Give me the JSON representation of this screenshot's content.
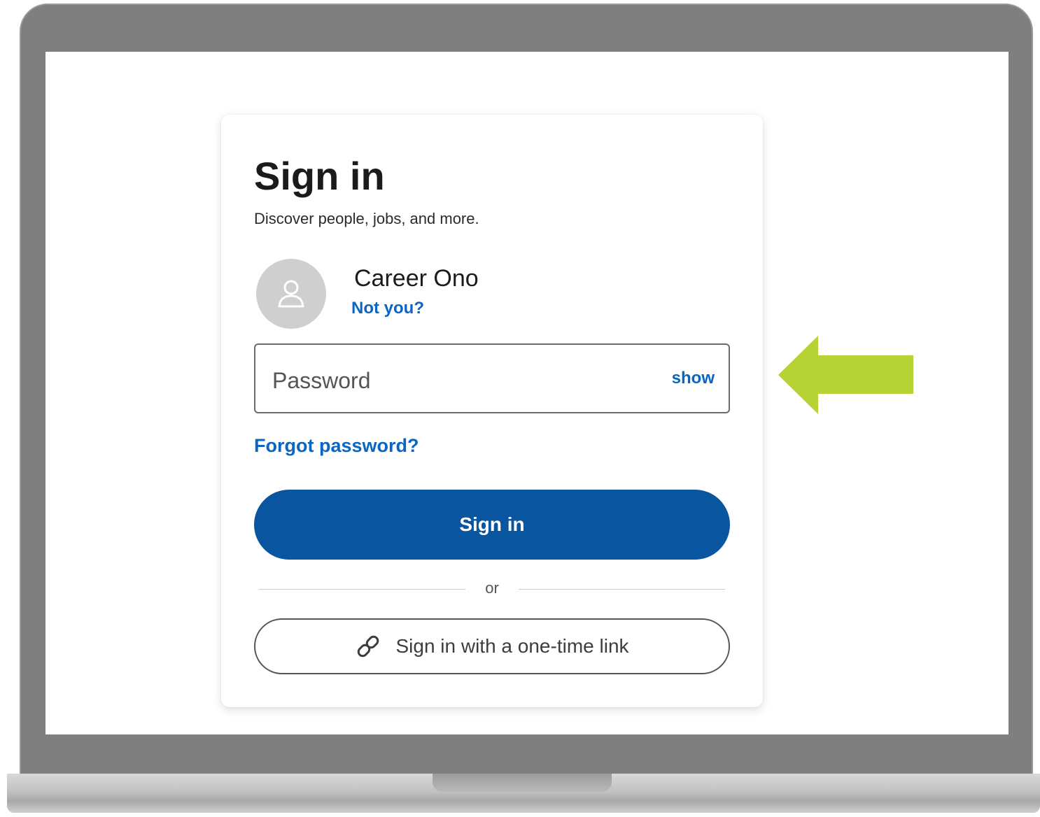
{
  "signin": {
    "title": "Sign in",
    "subtitle": "Discover people, jobs, and more.",
    "user": {
      "name": "Career Ono",
      "not_you": "Not you?"
    },
    "password": {
      "placeholder": "Password",
      "value": "",
      "show_label": "show"
    },
    "forgot_password": "Forgot password?",
    "primary_button": "Sign in",
    "divider_text": "or",
    "one_time_link_button": "Sign in with a one-time link"
  },
  "icons": {
    "avatar": "user-silhouette-icon",
    "link": "link-icon",
    "annotation": "arrow-left-icon"
  },
  "colors": {
    "accent_link": "#0a66c2",
    "primary_button": "#0a55a0",
    "annotation_arrow": "#b5d334",
    "device_frame": "#7f7f7f"
  }
}
